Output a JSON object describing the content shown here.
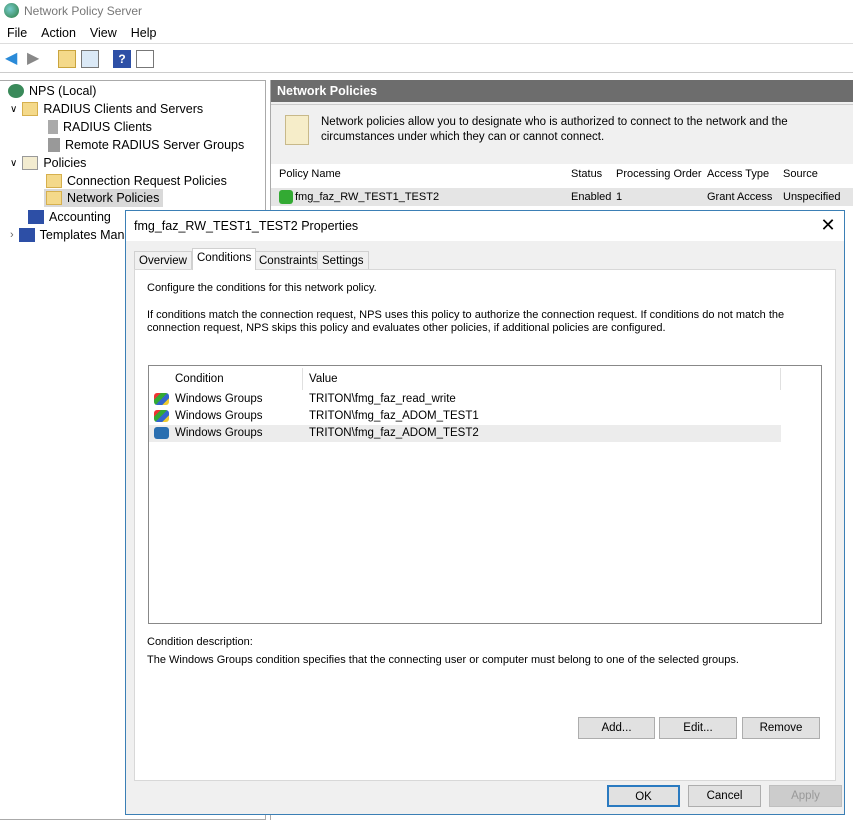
{
  "window": {
    "title": "Network Policy Server"
  },
  "menu": [
    "File",
    "Action",
    "View",
    "Help"
  ],
  "toolbar": [
    "back-icon",
    "forward-icon",
    "up-folder-icon",
    "show-hide-tree-icon",
    "help-icon",
    "action-pane-icon"
  ],
  "tree": [
    {
      "label": "NPS (Local)"
    },
    {
      "label": "RADIUS Clients and Servers"
    },
    {
      "label": "RADIUS Clients"
    },
    {
      "label": "Remote RADIUS Server Groups"
    },
    {
      "label": "Policies"
    },
    {
      "label": "Connection Request Policies"
    },
    {
      "label": "Network Policies"
    },
    {
      "label": "Accounting"
    },
    {
      "label": "Templates Management"
    }
  ],
  "right": {
    "header": "Network Policies",
    "description": "Network policies allow you to designate who is authorized to connect to the network and the circumstances under which they can or cannot connect.",
    "columns": [
      "Policy Name",
      "Status",
      "Processing Order",
      "Access Type",
      "Source"
    ],
    "row": {
      "name": "fmg_faz_RW_TEST1_TEST2",
      "status": "Enabled",
      "order": "1",
      "access": "Grant Access",
      "source": "Unspecified"
    }
  },
  "dialog": {
    "title": "fmg_faz_RW_TEST1_TEST2 Properties",
    "tabs": [
      "Overview",
      "Conditions",
      "Constraints",
      "Settings"
    ],
    "intro": "Configure the conditions for this network policy.",
    "explain": "If conditions match the connection request, NPS uses this policy to authorize the connection request. If conditions do not match the connection request, NPS skips this policy and evaluates other policies, if additional policies are configured.",
    "list_columns": [
      "Condition",
      "Value"
    ],
    "conditions": [
      {
        "condition": "Windows Groups",
        "value": "TRITON\\fmg_faz_read_write"
      },
      {
        "condition": "Windows Groups",
        "value": "TRITON\\fmg_faz_ADOM_TEST1"
      },
      {
        "condition": "Windows Groups",
        "value": "TRITON\\fmg_faz_ADOM_TEST2"
      }
    ],
    "desc_label": "Condition description:",
    "desc_text": "The Windows Groups condition specifies that the connecting user or computer must belong to one of the selected groups.",
    "buttons": {
      "add": "Add...",
      "edit": "Edit...",
      "remove": "Remove",
      "ok": "OK",
      "cancel": "Cancel",
      "apply": "Apply"
    }
  }
}
